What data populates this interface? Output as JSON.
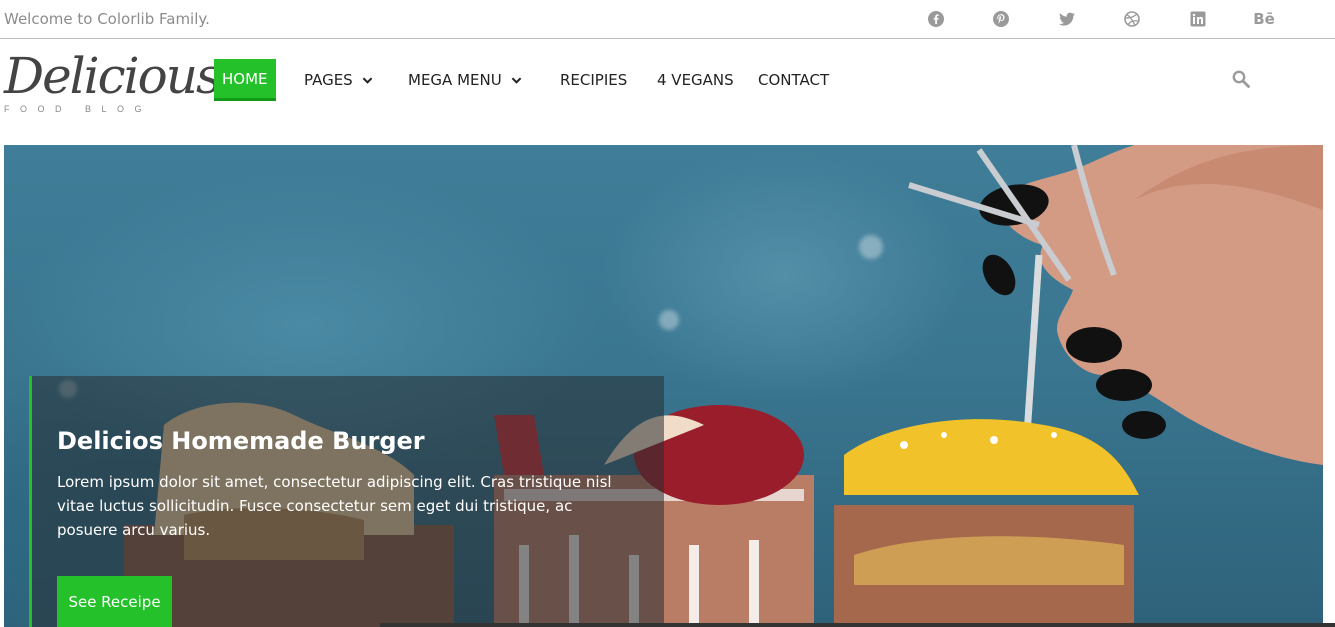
{
  "topbar": {
    "welcome": "Welcome to Colorlib Family.",
    "social": [
      "facebook-icon",
      "pinterest-icon",
      "twitter-icon",
      "dribbble-icon",
      "linkedin-icon",
      "behance-icon"
    ],
    "behance_label": "Bē"
  },
  "logo": {
    "title": "Delicious",
    "subtitle": "FOOD BLOG"
  },
  "nav": {
    "items": [
      {
        "label": "HOME",
        "active": true
      },
      {
        "label": "PAGES",
        "dropdown": true
      },
      {
        "label": "MEGA MENU",
        "dropdown": true
      },
      {
        "label": "RECIPIES"
      },
      {
        "label": "4 VEGANS"
      },
      {
        "label": "CONTACT"
      }
    ]
  },
  "hero": {
    "title": "Delicios Homemade Burger",
    "text": "Lorem ipsum dolor sit amet, consectetur adipiscing elit. Cras tristique nisl vitae luctus sollicitudin. Fusce consectetur sem eget dui tristique, ac posuere arcu varius.",
    "button": "See Receipe"
  },
  "colors": {
    "accent": "#25c12b",
    "muted": "#9a9a9a"
  }
}
